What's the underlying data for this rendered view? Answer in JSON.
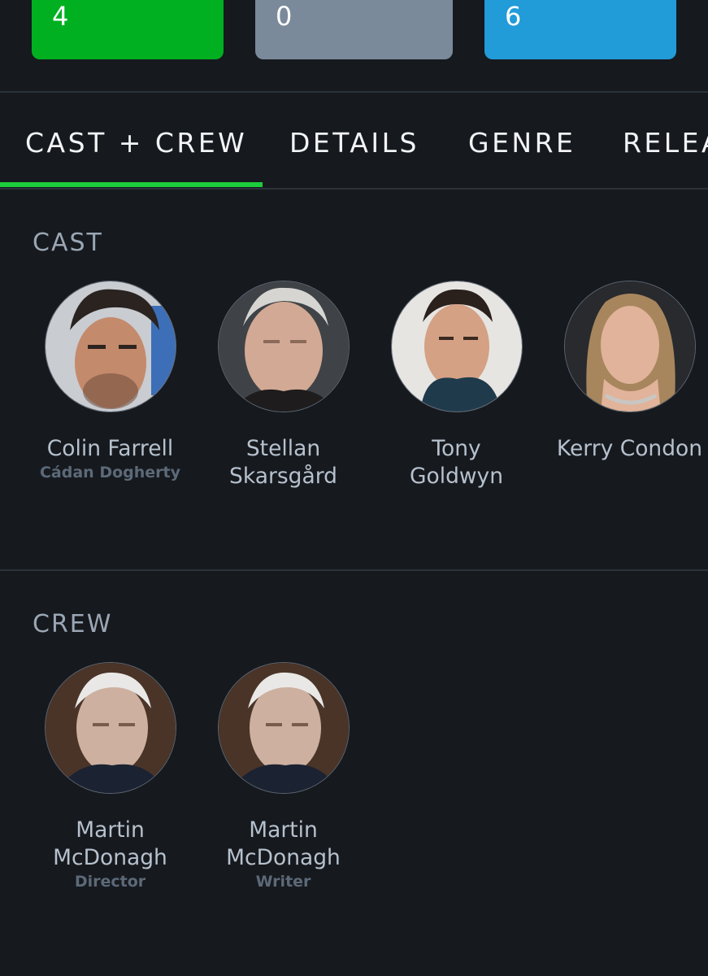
{
  "ratings": {
    "green": "4",
    "grey": "0",
    "blue": "6"
  },
  "tabs": [
    {
      "label": "CAST + CREW",
      "active": true
    },
    {
      "label": "DETAILS",
      "active": false
    },
    {
      "label": "GENRE",
      "active": false
    },
    {
      "label": "RELEA",
      "active": false
    }
  ],
  "cast": {
    "title": "CAST",
    "people": [
      {
        "name": "Colin Farrell",
        "role": "Cádan Dogherty"
      },
      {
        "name": "Stellan\nSkarsgård",
        "role": ""
      },
      {
        "name": "Tony\nGoldwyn",
        "role": ""
      },
      {
        "name": "Kerry Condon",
        "role": ""
      }
    ]
  },
  "crew": {
    "title": "CREW",
    "people": [
      {
        "name": "Martin\nMcDonagh",
        "role": "Director"
      },
      {
        "name": "Martin\nMcDonagh",
        "role": "Writer"
      }
    ]
  },
  "colors": {
    "background": "#16191e",
    "green": "#00b020",
    "grey": "#7a8a9b",
    "blue": "#229bd9",
    "tab_indicator": "#1ccd3c"
  }
}
